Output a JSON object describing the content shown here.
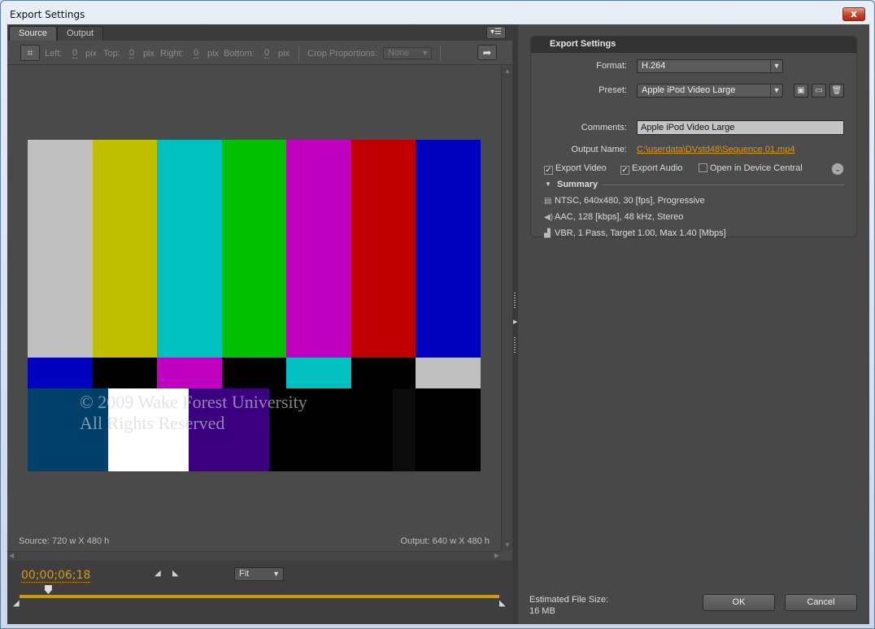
{
  "window": {
    "title": "Export Settings",
    "close_glyph": "x"
  },
  "tabs": [
    {
      "label": "Source"
    },
    {
      "label": "Output"
    }
  ],
  "crop_toolbar": {
    "left_label": "Left:",
    "left_value": "0",
    "left_unit": "pix",
    "top_label": "Top:",
    "top_value": "0",
    "top_unit": "pix",
    "right_label": "Right:",
    "right_value": "0",
    "right_unit": "pix",
    "bottom_label": "Bottom:",
    "bottom_value": "0",
    "bottom_unit": "pix",
    "proportions_label": "Crop Proportions:",
    "proportions_value": "None"
  },
  "preview": {
    "watermark_line1": "© 2009 Wake Forest University",
    "watermark_line2": "All Rights Reserved",
    "source_dimensions": "Source: 720 w X 480 h",
    "output_dimensions": "Output: 640 w X 480 h",
    "colors": {
      "top_bars": [
        "#c0c0c0",
        "#c0c000",
        "#00c0c0",
        "#00c000",
        "#c000c0",
        "#c00000",
        "#0000c0"
      ],
      "mid_bars": [
        "#0000c0",
        "#000000",
        "#c000c0",
        "#000000",
        "#00c0c0",
        "#000000",
        "#c0c0c0"
      ],
      "bottom_bars": [
        "#00406a",
        "#ffffff",
        "#3a0080",
        "#000000",
        "#000000",
        "#000000"
      ]
    }
  },
  "timeline": {
    "timecode": "00;00;06;18",
    "zoom": "Fit",
    "playhead_position": 0.06
  },
  "settings": {
    "header": "Export Settings",
    "format_label": "Format:",
    "format_value": "H.264",
    "preset_label": "Preset:",
    "preset_value": "Apple iPod Video Large",
    "comments_label": "Comments:",
    "comments_value": "Apple iPod Video Large",
    "output_name_label": "Output Name:",
    "output_name_value": "C:\\userdata\\DVstd48\\Sequence 01.mp4",
    "export_video_label": "Export Video",
    "export_audio_label": "Export Audio",
    "device_central_label": "Open in Device Central",
    "export_video_checked": true,
    "export_audio_checked": true,
    "device_central_checked": false,
    "summary_label": "Summary",
    "summary_video": "NTSC, 640x480, 30 [fps], Progressive",
    "summary_audio": "AAC, 128 [kbps], 48 kHz, Stereo",
    "summary_bitrate": "VBR, 1 Pass, Target 1.00, Max 1.40 [Mbps]"
  },
  "footer": {
    "est_size_label": "Estimated File Size:",
    "est_size_value": "16 MB",
    "ok_label": "OK",
    "cancel_label": "Cancel"
  },
  "accent_color": "#d99a12"
}
